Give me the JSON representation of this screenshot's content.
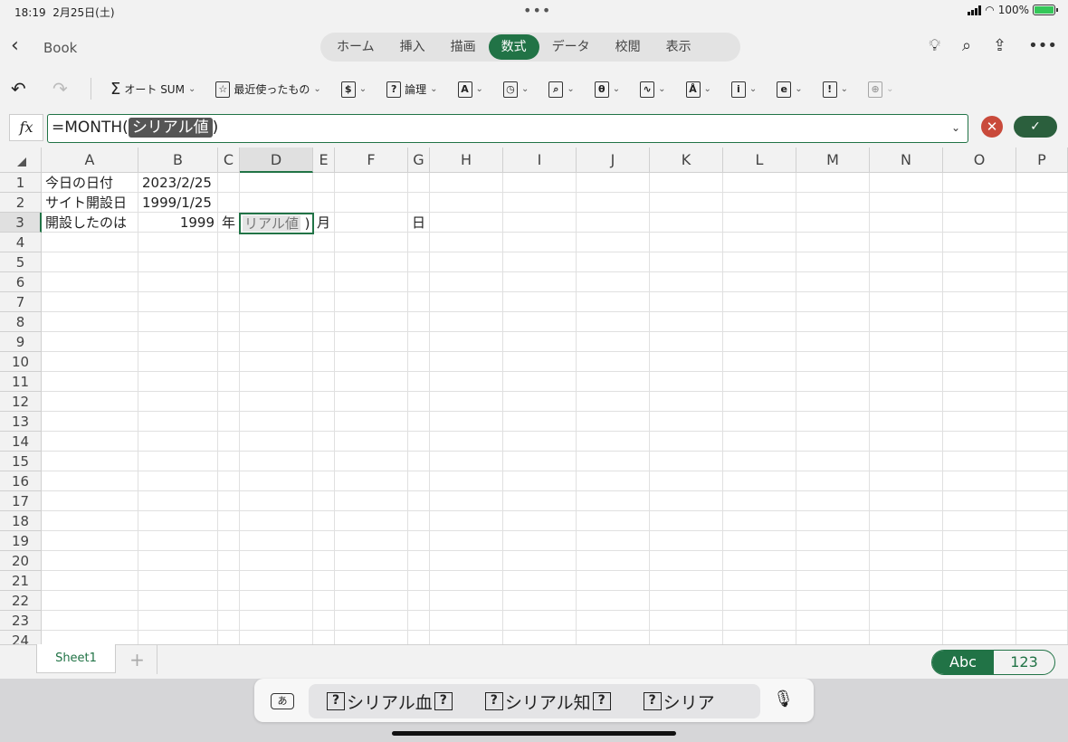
{
  "status": {
    "time": "18:19",
    "date": "2月25日(土)",
    "battery": "100%"
  },
  "nav": {
    "title": "Book",
    "tabs": [
      "ホーム",
      "挿入",
      "描画",
      "数式",
      "データ",
      "校閲",
      "表示"
    ],
    "active_tab": "数式"
  },
  "ribbon": {
    "autosum": "オート SUM",
    "recent": "最近使ったもの",
    "logic": "論理"
  },
  "formula": {
    "prefix": "=MONTH(",
    "token": "シリアル値",
    "suffix": ")"
  },
  "columns": [
    "A",
    "B",
    "C",
    "D",
    "E",
    "F",
    "G",
    "H",
    "I",
    "J",
    "K",
    "L",
    "M",
    "N",
    "O",
    "P"
  ],
  "rows": [
    "1",
    "2",
    "3",
    "4",
    "5",
    "6",
    "7",
    "8",
    "9",
    "10",
    "11",
    "12",
    "13",
    "14",
    "15",
    "16",
    "17",
    "18",
    "19",
    "20",
    "21",
    "22",
    "23",
    "24"
  ],
  "cells": {
    "a1": "今日の日付",
    "b1": "2023/2/25",
    "a2": "サイト開設日",
    "b2": "1999/1/25",
    "a3": "開設したのは",
    "b3": "1999",
    "c3": "年",
    "d3_token": "リアル値",
    "d3_suffix": ")",
    "e3": "月",
    "g3": "日"
  },
  "sheets": {
    "sheet1": "Sheet1",
    "add": "+"
  },
  "keyboard_toggle": {
    "abc": "Abc",
    "num": "123"
  },
  "suggestions": {
    "kana": "あ",
    "items": [
      "シリアル血",
      "シリアル知",
      "シリア"
    ]
  },
  "colors": {
    "accent": "#217346",
    "cancel": "#c94a3b",
    "confirm": "#2b5f3d"
  }
}
